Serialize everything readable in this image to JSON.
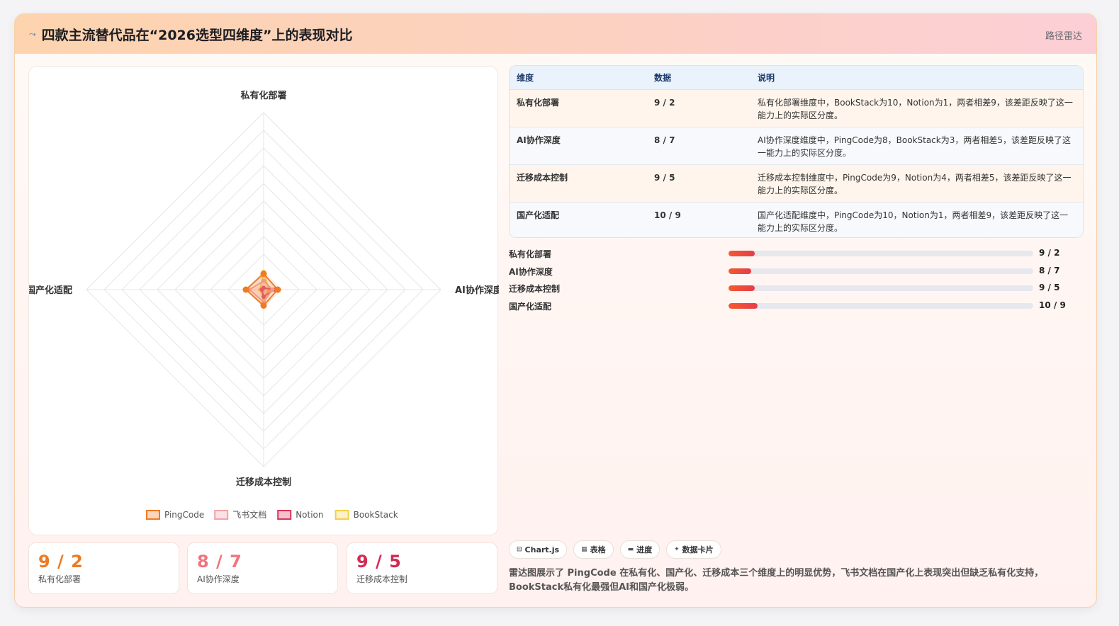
{
  "header": {
    "icon": "route-icon",
    "title": "四款主流替代品在“2026选型四维度”上的表现对比",
    "tag": "路径雷达"
  },
  "colors": {
    "PingCode": "#f07b22",
    "飞书文档": "#f3a2a8",
    "Notion": "#d8365a",
    "BookStack": "#f3cf4a",
    "accent": "#e8493c"
  },
  "chart_data": {
    "type": "radar",
    "axes": [
      "私有化部署",
      "AI协作深度",
      "迁移成本控制",
      "国产化适配"
    ],
    "scale": [
      0,
      100
    ],
    "series": [
      {
        "name": "PingCode",
        "values": [
          9,
          8,
          9,
          10
        ]
      },
      {
        "name": "飞书文档",
        "values": [
          5,
          5,
          7,
          8
        ]
      },
      {
        "name": "Notion",
        "values": [
          1,
          6,
          4,
          1
        ]
      },
      {
        "name": "BookStack",
        "values": [
          10,
          3,
          6,
          2
        ]
      }
    ],
    "grid": true,
    "legend_position": "bottom"
  },
  "table": {
    "headers": [
      "维度",
      "数据",
      "说明"
    ],
    "rows": [
      {
        "dim": "私有化部署",
        "value": "9 / 2",
        "desc": "私有化部署维度中，BookStack为10，Notion为1，两者相差9，该差距反映了这一能力上的实际区分度。"
      },
      {
        "dim": "AI协作深度",
        "value": "8 / 7",
        "desc": "AI协作深度维度中，PingCode为8，BookStack为3，两者相差5，该差距反映了这一能力上的实际区分度。"
      },
      {
        "dim": "迁移成本控制",
        "value": "9 / 5",
        "desc": "迁移成本控制维度中，PingCode为9，Notion为4，两者相差5，该差距反映了这一能力上的实际区分度。"
      },
      {
        "dim": "国产化适配",
        "value": "10 / 9",
        "desc": "国产化适配维度中，PingCode为10，Notion为1，两者相差9，该差距反映了这一能力上的实际区分度。"
      }
    ]
  },
  "progress": [
    {
      "label": "私有化部署",
      "value": "9 / 2",
      "fraction": 0.085
    },
    {
      "label": "AI协作深度",
      "value": "8 / 7",
      "fraction": 0.075
    },
    {
      "label": "迁移成本控制",
      "value": "9 / 5",
      "fraction": 0.085
    },
    {
      "label": "国产化适配",
      "value": "10 / 9",
      "fraction": 0.095
    }
  ],
  "kpis": [
    {
      "value": "9 / 2",
      "label": "私有化部署",
      "color": "#ee7a22"
    },
    {
      "value": "8 / 7",
      "label": "AI协作深度",
      "color": "#f0747e"
    },
    {
      "value": "9 / 5",
      "label": "迁移成本控制",
      "color": "#d42a52"
    }
  ],
  "chips": [
    {
      "icon": "chart-icon",
      "glyph": "⊟",
      "label": "Chart.js"
    },
    {
      "icon": "table-icon",
      "glyph": "▦",
      "label": "表格"
    },
    {
      "icon": "progress-icon",
      "glyph": "▬",
      "label": "进度"
    },
    {
      "icon": "card-icon",
      "glyph": "✦",
      "label": "数据卡片"
    }
  ],
  "summary": "雷达图展示了 PingCode 在私有化、国产化、迁移成本三个维度上的明显优势，飞书文档在国产化上表现突出但缺乏私有化支持，BookStack私有化最强但AI和国产化极弱。"
}
